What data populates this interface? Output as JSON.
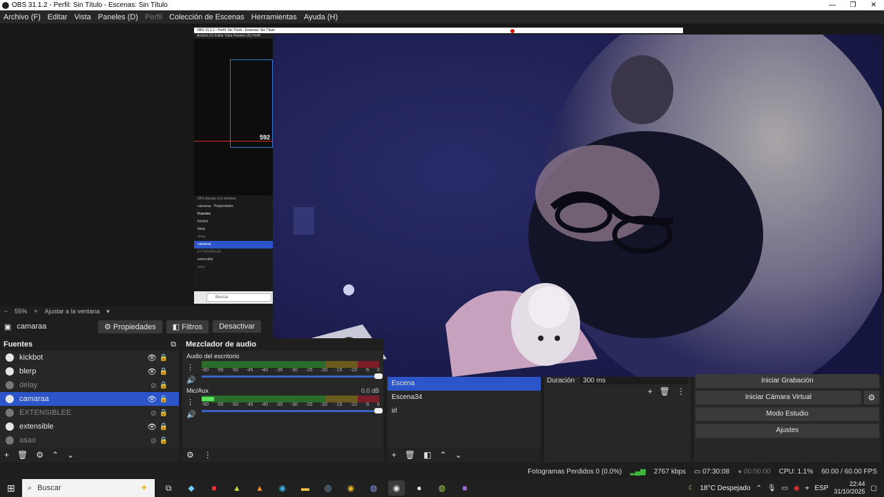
{
  "window": {
    "title": "OBS 31.1.2 - Perfil: Sin Título - Escenas: Sin Título"
  },
  "menu": [
    "Archivo (F)",
    "Editar",
    "Vista",
    "Paneles (D)",
    "Perfil",
    "Colección de Escenas",
    "Herramientas",
    "Ayuda (H)"
  ],
  "preview": {
    "nested_title": "OBS 31.1.2 - Perfil: Sin Título - Escenas: Sin Título",
    "nested_menu": "Archivo (F)   Editar   Vista   Paneles (D)   Perfil",
    "nested_label": "592",
    "nested_sources_header": "Fuentes",
    "nested_sources": [
      "kickbot",
      "blerp",
      "delay",
      "camaraa",
      "EXTENSIBLEE",
      "extensible",
      "asao"
    ],
    "nested_source_name": "camaraa",
    "nested_props": "Propiedades",
    "nested_zoom": "55%  Ajustar a la ventana",
    "nested_search": "Buscar"
  },
  "zoom": {
    "value": "55%",
    "fit_label": "Ajustar a la ventana"
  },
  "source_bar": {
    "name": "camaraa",
    "properties": "Propiedades",
    "filters": "Filtros",
    "deactivate": "Desactivar"
  },
  "sources": {
    "header": "Fuentes",
    "items": [
      {
        "label": "kickbot",
        "visible": true
      },
      {
        "label": "blerp",
        "visible": true
      },
      {
        "label": "delay",
        "visible": false
      },
      {
        "label": "camaraa",
        "visible": true,
        "selected": true
      },
      {
        "label": "EXTENSIBLEE",
        "visible": false
      },
      {
        "label": "extensible",
        "visible": true
      },
      {
        "label": "asao",
        "visible": false
      }
    ]
  },
  "mixer": {
    "header": "Mezclador de audio",
    "channels": [
      {
        "name": "Audio del escritorio",
        "db": ""
      },
      {
        "name": "Mic/Aux",
        "db": "0.0 dB"
      }
    ],
    "scale": [
      "-60",
      "-55",
      "-50",
      "-45",
      "-40",
      "-35",
      "-30",
      "-25",
      "-20",
      "-15",
      "-10",
      "-5",
      "0"
    ]
  },
  "scenes": {
    "items": [
      "Escena",
      "Escena34",
      "irl"
    ]
  },
  "transitions": {
    "duration_label": "Duración",
    "duration_value": "300 ms"
  },
  "controls": {
    "start_recording": "Iniciar Grabación",
    "start_virtual_cam": "Iniciar Cámara Virtual",
    "studio_mode": "Modo Estudio",
    "settings": "Ajustes"
  },
  "status": {
    "dropped_frames": "Fotogramas Perdidos 0 (0.0%)",
    "bitrate": "2767 kbps",
    "stream_time": "07:30:08",
    "rec_time": "00:00:00",
    "cpu": "CPU: 1.1%",
    "fps": "60.00 / 60.00 FPS"
  },
  "taskbar": {
    "search_placeholder": "Buscar",
    "weather": "18°C  Despejado",
    "lang": "ESP",
    "time": "22:44",
    "date": "31/10/2025"
  }
}
